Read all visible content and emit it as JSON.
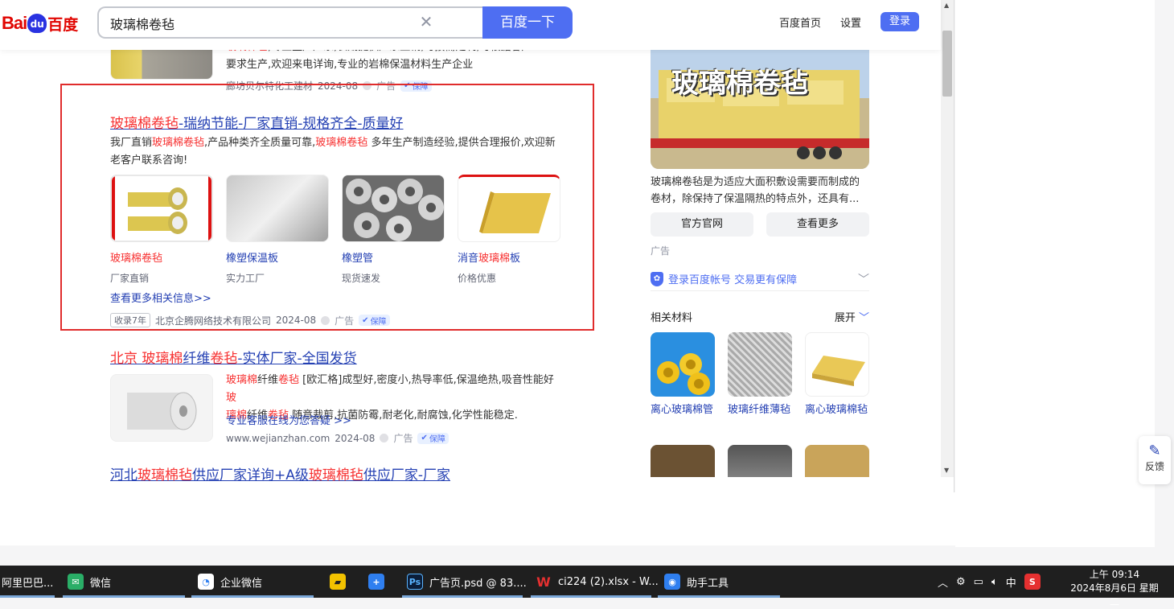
{
  "header": {
    "logo_bai": "Bai",
    "logo_du": "百度",
    "paw": "du",
    "search_value": "玻璃棉卷毡",
    "search_button": "百度一下",
    "links": [
      "百度首页",
      "设置"
    ],
    "login": "登录"
  },
  "prev_result": {
    "desc_line1_pre": "玻璃棉毡",
    "desc_line1": ",专业生产厂家,长期提供厂家直销,可按需定制,可根据客户",
    "desc_line2": "要求生产,欢迎来电详询,专业的岩棉保温材料生产企业",
    "source": "廊坊贝尔特化工建材",
    "date": "2024-08",
    "ad": "广告",
    "shield": "保障"
  },
  "ad_result": {
    "title_em": "玻璃棉卷毡",
    "title_rest": "-瑞纳节能-厂家直销-规格齐全-质量好",
    "desc_1": "我厂直销",
    "desc_em1": "玻璃棉卷毡",
    "desc_2": ",产品种类齐全质量可靠,",
    "desc_em2": "玻璃棉卷毡",
    "desc_3": " 多年生产制造经验,提供合理报价,欢迎新",
    "desc_4": "老客户联系咨询!",
    "products": [
      {
        "title_em": "玻璃棉卷毡",
        "title_rest": "",
        "sub": "厂家直销"
      },
      {
        "title_em": "",
        "title_rest": "橡塑保温板",
        "sub": "实力工厂"
      },
      {
        "title_em": "",
        "title_rest": "橡塑管",
        "sub": "现货速发"
      },
      {
        "title_pre": "消音",
        "title_em": "玻璃棉",
        "title_rest": "板",
        "sub": "价格优惠"
      }
    ],
    "more": "查看更多相关信息>>",
    "years": "收录7年",
    "source": "北京企腾网络技术有限公司",
    "date": "2024-08",
    "ad": "广告",
    "shield": "保障"
  },
  "result3": {
    "title_em1": "北京 玻璃棉",
    "title_mid": "纤维",
    "title_em2": "卷毡",
    "title_rest": "-实体厂家-全国发货",
    "d1_em": "玻璃棉",
    "d1_a": "纤维",
    "d1_em2": "卷毡",
    "d1_b": " [欧汇格]成型好,密度小,热导率低,保温绝热,吸音性能好",
    "d1_em3": "玻",
    "d2_em": "璃棉",
    "d2_a": "纤维",
    "d2_em2": "卷毡",
    "d2_b": " 随意裁剪,抗菌防霉,耐老化,耐腐蚀,化学性能稳定.",
    "link": "专业客服在线为您答疑 >>",
    "source": "www.wejianzhan.com",
    "date": "2024-08",
    "ad": "广告",
    "shield": "保障"
  },
  "result4": {
    "t1": "河北",
    "em1": "玻璃棉毡",
    "t2": "供应厂家详询+A级",
    "em2": "玻璃棉毡",
    "t3": "供应厂家-厂家"
  },
  "right": {
    "banner_text": "玻璃棉卷毡",
    "desc": "玻璃棉卷毡是为适应大面积敷设需要而制成的卷材，除保持了保温隔热的特点外，还具有...",
    "btn_official": "官方官网",
    "btn_more": "查看更多",
    "ad": "广告",
    "login_text": "登录百度帐号 交易更有保障",
    "related_title": "相关材料",
    "expand": "展开",
    "related": [
      {
        "label": "离心玻璃棉管"
      },
      {
        "label": "玻璃纤维薄毡"
      },
      {
        "label": "离心玻璃棉毡"
      }
    ]
  },
  "feedback": "反馈",
  "taskbar": {
    "items": [
      "阿里巴巴...",
      "微信",
      "企业微信",
      "",
      "",
      "广告页.psd @ 83....",
      "ci224 (2).xlsx - W...",
      "助手工具"
    ],
    "tray_ime": "中",
    "time": "上午 09:14",
    "date": "2024年8月6日 星期二"
  }
}
